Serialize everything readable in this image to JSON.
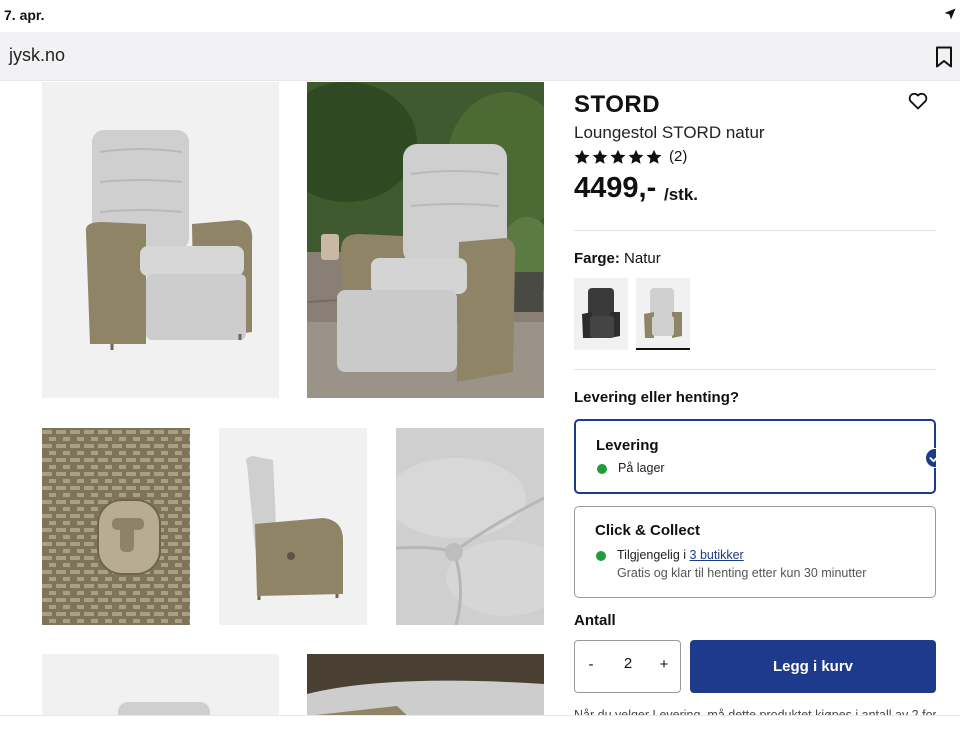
{
  "status_bar": {
    "date": "7. apr.",
    "location_icon": "location-arrow-icon"
  },
  "address_bar": {
    "url": "jysk.no",
    "bookmark_icon": "bookmark-icon"
  },
  "product": {
    "brand": "STORD",
    "name": "Loungestol STORD natur",
    "rating_stars": 5,
    "review_count": "(2)",
    "price": "4499,-",
    "unit": "/stk.",
    "favorite_icon": "heart-icon"
  },
  "color_selector": {
    "label": "Farge:",
    "value": "Natur",
    "swatches": [
      {
        "name": "Black variant",
        "selected": false
      },
      {
        "name": "Natur",
        "selected": true
      }
    ]
  },
  "delivery": {
    "question": "Levering eller henting?",
    "options": [
      {
        "title": "Levering",
        "status": "På lager",
        "selected": true
      },
      {
        "title": "Click & Collect",
        "status_prefix": "Tilgjengelig i",
        "status_link": "3 butikker",
        "note": "Gratis og klar til henting etter kun 30 minutter",
        "selected": false
      }
    ]
  },
  "quantity": {
    "label": "Antall",
    "minus": "-",
    "value": "2",
    "plus": "+"
  },
  "cart": {
    "button_label": "Legg i kurv"
  },
  "bottom_note": "Når du velger Levering, må dette produktet kjøpes i antall av 2 for",
  "colors": {
    "primary_blue": "#1e3a8a",
    "stock_green": "#1f9d3a",
    "address_bar_bg": "#f2f2f4"
  }
}
